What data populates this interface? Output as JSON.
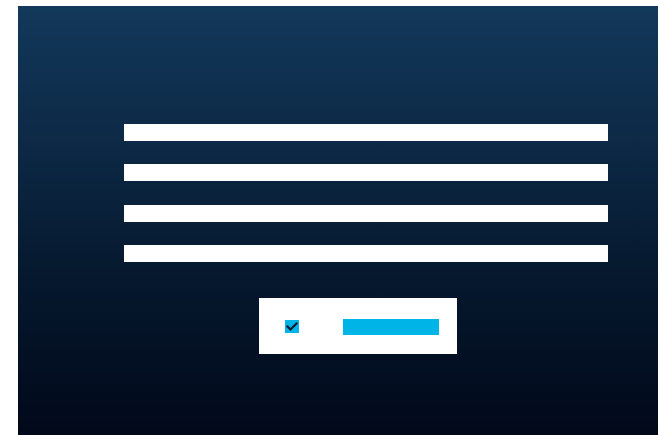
{
  "form": {
    "fields": [
      {
        "value": "",
        "placeholder": ""
      },
      {
        "value": "",
        "placeholder": ""
      },
      {
        "value": "",
        "placeholder": ""
      },
      {
        "value": "",
        "placeholder": ""
      }
    ],
    "checkbox": {
      "checked": true,
      "icon": "checkmark-icon"
    },
    "action_button": {
      "label": ""
    }
  },
  "colors": {
    "background_top": "#12385a",
    "background_bottom": "#01081a",
    "field": "#ffffff",
    "accent": "#00b4e8",
    "checkmark": "#0a1a2e"
  }
}
